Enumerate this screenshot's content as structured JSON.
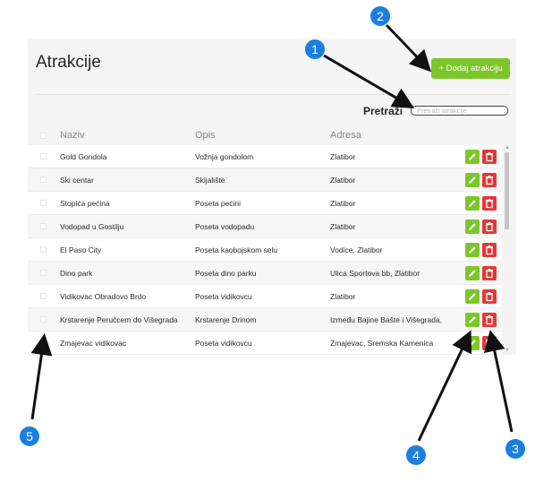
{
  "page": {
    "title": "Atrakcije",
    "add_button": "+ Dodaj atrakciju",
    "search_label": "Pretraži",
    "search_placeholder": "Pretraži atrakcije"
  },
  "table": {
    "columns": [
      "Naziv",
      "Opis",
      "Adresa"
    ],
    "rows": [
      {
        "name": "Gold Gondola",
        "opis": "Vožnja gondolom",
        "adresa": "Zlatibor"
      },
      {
        "name": "Ski centar",
        "opis": "Skijalište",
        "adresa": "Zlatibor"
      },
      {
        "name": "Stopića pećina",
        "opis": "Poseta pećini",
        "adresa": "Zlatibor"
      },
      {
        "name": "Vodopad u Gostilju",
        "opis": "Poseta vodopadu",
        "adresa": "Zlatibor"
      },
      {
        "name": "El Paso City",
        "opis": "Poseta kaobojskom selu",
        "adresa": "Vodice, Zlatibor"
      },
      {
        "name": "Dino park",
        "opis": "Poseta dino parku",
        "adresa": "Ulica Sportova bb, Zlatibor"
      },
      {
        "name": "Vidikovac Obradovo Brdo",
        "opis": "Poseta vidikovcu",
        "adresa": "Zlatibor"
      },
      {
        "name": "Krstarenje Perućcem do Višegrada",
        "opis": "Krstarenje Drinom",
        "adresa": "Između Bajine Bašte i Višegrada,"
      },
      {
        "name": "Zmajevac vidikovac",
        "opis": "Poseta vidikovcu",
        "adresa": "Zmajevac, Sremska Kamenica"
      }
    ]
  },
  "icons": {
    "edit": "pencil-icon",
    "delete": "trash-icon",
    "header_checkbox": "checkbox",
    "scroll_up": "▲",
    "scroll_down": "▼"
  },
  "annotations": [
    "1",
    "2",
    "3",
    "4",
    "5"
  ],
  "colors": {
    "accent_green": "#7cc62a",
    "danger_red": "#e23838",
    "marker_blue": "#1a7fe0",
    "arrow": "#111111"
  }
}
